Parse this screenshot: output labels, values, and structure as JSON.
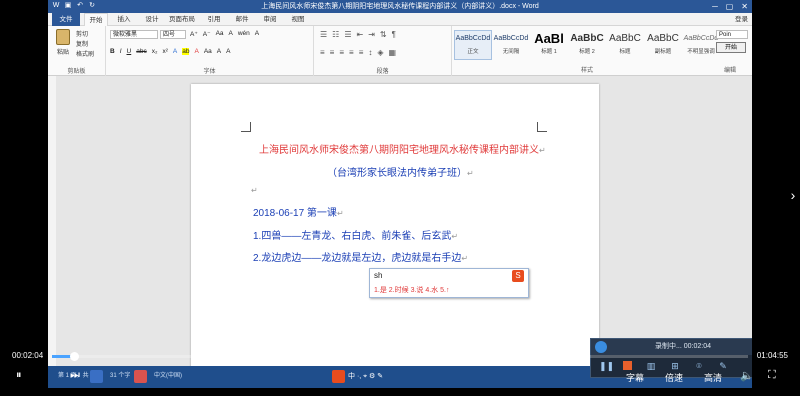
{
  "window": {
    "title": "上海民间风水师宋俊杰第八期阴阳宅地理风水秘传课程内部讲义（内部讲义）.docx - Word",
    "minimize": "─",
    "maximize": "▢",
    "close": "✕"
  },
  "ribbon_tabs": [
    "文件",
    "开始",
    "插入",
    "设计",
    "页面布局",
    "引用",
    "邮件",
    "审阅",
    "视图"
  ],
  "login": "登录",
  "clipboard": {
    "paste": "粘贴",
    "cut": "剪切",
    "copy": "复制",
    "format_painter": "格式刷",
    "label": "剪贴板"
  },
  "font": {
    "name": "微软雅黑",
    "size": "四号",
    "label": "字体",
    "row1": [
      "A⁺",
      "A⁻",
      "Aa",
      "A",
      "wén",
      "A"
    ],
    "row2": [
      "B",
      "I",
      "U",
      "abc",
      "x₂",
      "x²",
      "A",
      "ab",
      "A",
      "Aa",
      "A",
      "A"
    ]
  },
  "paragraph": {
    "label": "段落"
  },
  "styles": {
    "label": "样式",
    "items": [
      {
        "sample": "AaBbCcDd",
        "name": "正文"
      },
      {
        "sample": "AaBbCcDd",
        "name": "无间隔"
      },
      {
        "sample": "AaBl",
        "name": "标题 1"
      },
      {
        "sample": "AaBbC",
        "name": "标题 2"
      },
      {
        "sample": "AaBbC",
        "name": "标题"
      },
      {
        "sample": "AaBbC",
        "name": "副标题"
      },
      {
        "sample": "AaBbCcDd",
        "name": "不明显强调"
      }
    ]
  },
  "editing": {
    "label": "编辑",
    "find_value": "Poin",
    "find_button": "开始"
  },
  "document": {
    "title_line": "上海民间风水师宋俊杰第八期阴阳宅地理风水秘传课程内部讲义",
    "subtitle_line": "（台湾形家长眼法内传弟子班）",
    "date_line": "2018-06-17 第一课",
    "item1": "1.四兽——左青龙、右白虎、前朱雀、后玄武",
    "item2": "2.龙边虎边——龙边就是左边，虎边就是右手边",
    "para_mark": "↵"
  },
  "ime": {
    "composition": "sh",
    "candidates": "1.是  2.时候  3.说  4.水  5.↑",
    "logo": "S"
  },
  "taskbar": {
    "page_status": "第 1 页，共 1 页",
    "words": "31 个字",
    "language": "中文(中国)",
    "ime_tray": "中 ·, ⌖ ⚙ ✎"
  },
  "recorder": {
    "status": "录制中... 00:02:04",
    "close": "✕"
  },
  "player": {
    "current_time": "00:02:04",
    "total_time": "01:04:55",
    "progress": 0.032,
    "play_pause": "⏸",
    "next": "⏭",
    "subtitles": "字幕",
    "speed": "倍速",
    "quality": "高清",
    "volume": "🔈",
    "fullscreen": "⛶",
    "side_arrow": "›"
  }
}
